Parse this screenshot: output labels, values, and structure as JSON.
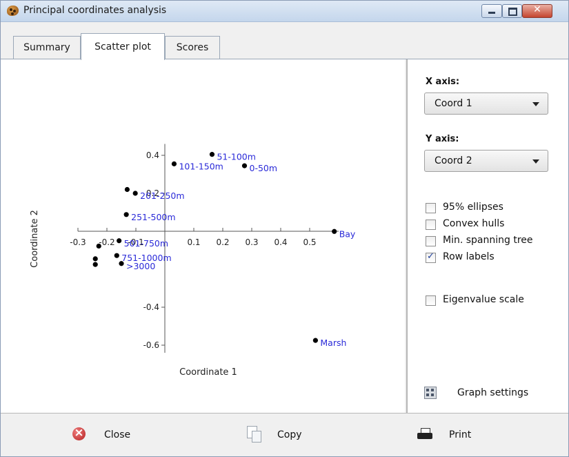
{
  "window": {
    "title": "Principal coordinates analysis",
    "controls": {
      "minimize_icon": "minimize-icon",
      "maximize_icon": "maximize-icon",
      "close_icon": "close-icon",
      "close_symbol": "✕"
    }
  },
  "tabs": [
    {
      "label": "Summary",
      "active": false
    },
    {
      "label": "Scatter plot",
      "active": true
    },
    {
      "label": "Scores",
      "active": false
    }
  ],
  "chart_data": {
    "type": "scatter",
    "xlabel": "Coordinate 1",
    "ylabel": "Coordinate 2",
    "x_ticks": [
      -0.3,
      -0.2,
      -0.1,
      0.1,
      0.2,
      0.3,
      0.4,
      0.5
    ],
    "x_tick_labels": [
      "-0.3",
      "-0.2",
      "-0.1",
      "0.1",
      "0.2",
      "0.3",
      "0.4",
      "0.5"
    ],
    "y_ticks": [
      0.4,
      0.2,
      -0.4,
      -0.6
    ],
    "y_tick_labels": [
      "0.4",
      "0.2",
      "-0.4",
      "-0.6"
    ],
    "points": [
      {
        "x": 0.163,
        "y": 0.405,
        "label": "51-100m"
      },
      {
        "x": 0.032,
        "y": 0.355,
        "label": "101-150m"
      },
      {
        "x": 0.275,
        "y": 0.345,
        "label": "0-50m"
      },
      {
        "x": -0.13,
        "y": 0.22,
        "label": ""
      },
      {
        "x": -0.102,
        "y": 0.2,
        "label": "201-250m"
      },
      {
        "x": -0.133,
        "y": 0.088,
        "label": "251-500m"
      },
      {
        "x": 0.585,
        "y": -0.001,
        "label": "Bay"
      },
      {
        "x": -0.158,
        "y": -0.05,
        "label": "501-750m"
      },
      {
        "x": -0.228,
        "y": -0.078,
        "label": ""
      },
      {
        "x": -0.166,
        "y": -0.128,
        "label": "751-1000m"
      },
      {
        "x": -0.24,
        "y": -0.145,
        "label": ""
      },
      {
        "x": -0.24,
        "y": -0.175,
        "label": ""
      },
      {
        "x": -0.15,
        "y": -0.17,
        "label": ">3000"
      },
      {
        "x": 0.52,
        "y": -0.575,
        "label": "Marsh"
      }
    ],
    "label_color": "#2a2ad8",
    "point_color": "#000000",
    "grid": false
  },
  "side": {
    "x_axis": {
      "label": "X axis:",
      "value": "Coord 1"
    },
    "y_axis": {
      "label": "Y axis:",
      "value": "Coord 2"
    },
    "options": [
      {
        "label": "95% ellipses",
        "checked": false
      },
      {
        "label": "Convex hulls",
        "checked": false
      },
      {
        "label": "Min. spanning tree",
        "checked": false
      },
      {
        "label": "Row labels",
        "checked": true
      }
    ],
    "eigen": {
      "label": "Eigenvalue scale",
      "checked": false
    },
    "check_mark": "✓",
    "graph_settings": "Graph settings"
  },
  "buttons": {
    "close": "Close",
    "copy": "Copy",
    "print": "Print"
  },
  "colors": {
    "title_bar": "#c4d6ec",
    "close_button": "#c4452f",
    "label_blue": "#2a2ad8"
  }
}
